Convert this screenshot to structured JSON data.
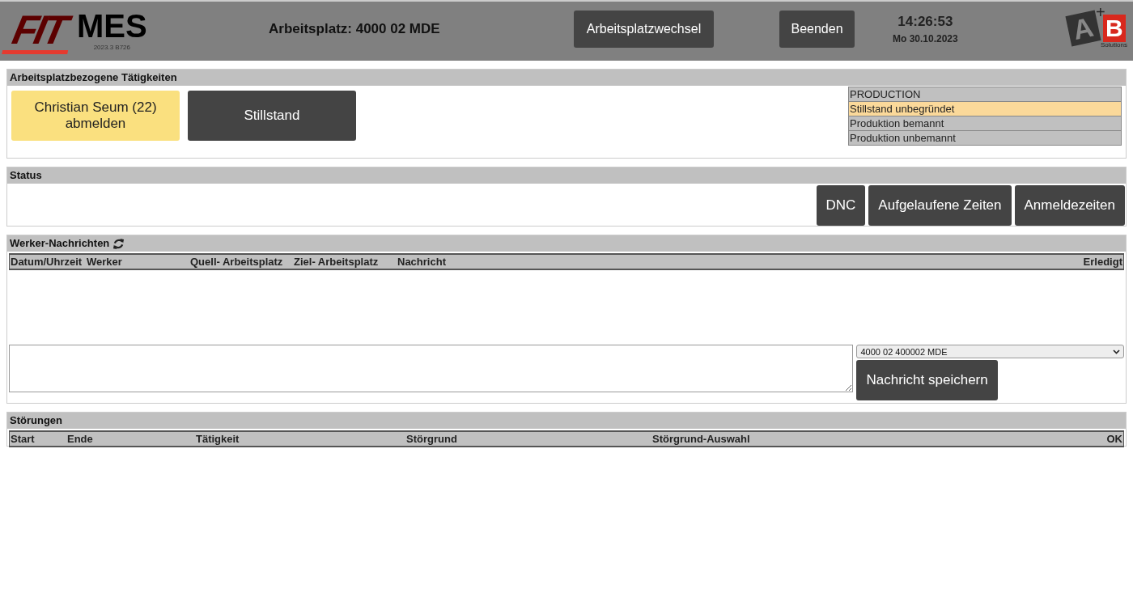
{
  "header": {
    "logo": {
      "mark": "FIT",
      "name": "MES",
      "version": "2023.3 B726"
    },
    "workplace": "Arbeitsplatz: 4000 02 MDE",
    "buttons": [
      "Arbeitsplatzwechsel",
      "Beenden"
    ],
    "time": "14:26:53",
    "date": "Mo 30.10.2023",
    "brand": {
      "a": "A",
      "plus": "+",
      "b": "B",
      "sub": "Solutions"
    }
  },
  "activities": {
    "title": "Arbeitsplatzbezogene Tätigkeiten",
    "buttons": [
      {
        "kind": "worker",
        "label": "Christian Seum (22)\nabmelden"
      },
      {
        "kind": "dark",
        "label": "Stillstand"
      }
    ],
    "states": [
      {
        "label": "PRODUCTION",
        "selected": false
      },
      {
        "label": "Stillstand unbegründet",
        "selected": true
      },
      {
        "label": "Produktion bemannt",
        "selected": false
      },
      {
        "label": "Produktion unbemannt",
        "selected": false
      }
    ]
  },
  "status": {
    "title": "Status",
    "buttons": [
      "DNC",
      "Aufgelaufene Zeiten",
      "Anmeldezeiten"
    ]
  },
  "messages": {
    "title": "Werker-Nachrichten",
    "columns": [
      "Datum/Uhrzeit",
      "Werker",
      "Quell- Arbeitsplatz",
      "Ziel- Arbeitsplatz",
      "Nachricht",
      "Erledigt"
    ],
    "target": "4000 02 400002 MDE",
    "save": "Nachricht speichern"
  },
  "faults": {
    "title": "Störungen",
    "columns": [
      "Start",
      "Ende",
      "Tätigkeit",
      "Störgrund",
      "Störgrund-Auswahl",
      "OK"
    ]
  }
}
